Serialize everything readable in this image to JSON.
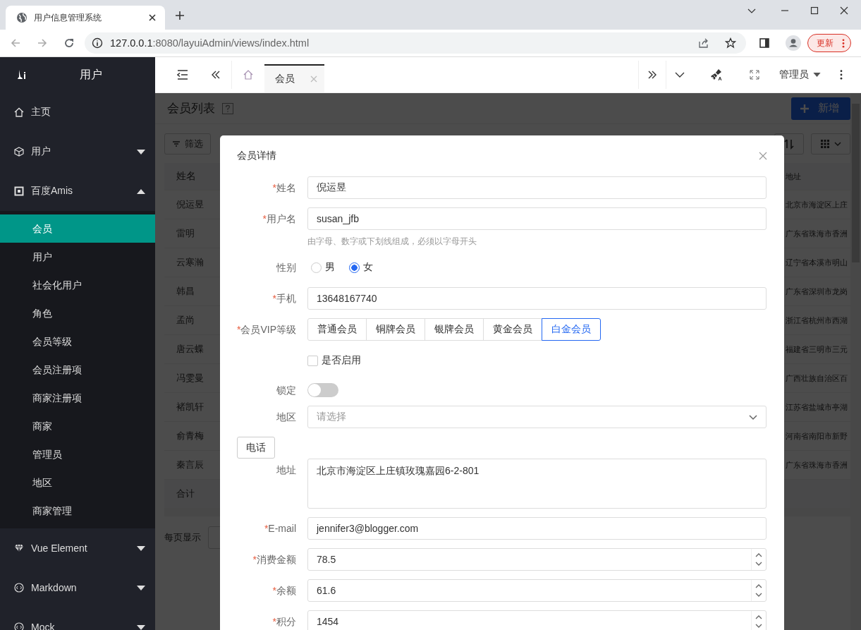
{
  "browser": {
    "tab_title": "用户信息管理系统",
    "url_host": "127.0.0.1",
    "url_path": ":8080/layuiAdmin/views/index.html",
    "update_button": "更新"
  },
  "sidebar": {
    "title": "用户",
    "items": [
      {
        "kind": "link",
        "label": "主页"
      },
      {
        "kind": "group",
        "label": "用户",
        "expanded": false
      },
      {
        "kind": "group",
        "label": "百度Amis",
        "expanded": true,
        "children": [
          {
            "label": "会员",
            "selected": true
          },
          {
            "label": "用户",
            "selected": false
          },
          {
            "label": "社会化用户",
            "selected": false
          },
          {
            "label": "角色",
            "selected": false
          },
          {
            "label": "会员等级",
            "selected": false
          },
          {
            "label": "会员注册项",
            "selected": false
          },
          {
            "label": "商家注册项",
            "selected": false
          },
          {
            "label": "商家",
            "selected": false
          },
          {
            "label": "管理员",
            "selected": false
          },
          {
            "label": "地区",
            "selected": false
          },
          {
            "label": "商家管理",
            "selected": false
          }
        ]
      },
      {
        "kind": "group",
        "label": "Vue Element",
        "expanded": false
      },
      {
        "kind": "group",
        "label": "Markdown",
        "expanded": false
      },
      {
        "kind": "group",
        "label": "Mock",
        "expanded": false
      }
    ]
  },
  "header": {
    "tabs": [
      {
        "label": "会员",
        "selected": true
      }
    ],
    "user": "管理员"
  },
  "page": {
    "title": "会员列表",
    "add_button": "新增",
    "filter_button": "筛选",
    "columns": [
      "姓名",
      "地址"
    ],
    "rows": [
      {
        "name": "倪运昱",
        "address": "北京市海淀区上庄"
      },
      {
        "name": "雷明",
        "address": "广东省珠海市香洲"
      },
      {
        "name": "云寒瀚",
        "address": "辽宁省本溪市明山"
      },
      {
        "name": "韩昌",
        "address": "广东省深圳市龙岗"
      },
      {
        "name": "孟尚",
        "address": "浙江省杭州市西湖"
      },
      {
        "name": "唐云蝶",
        "address": "福建省三明市三元"
      },
      {
        "name": "冯雯曼",
        "address": "广西壮族自治区百"
      },
      {
        "name": "褚凯轩",
        "address": "江苏省盐城市亭湖"
      },
      {
        "name": "俞青梅",
        "address": "河南省南阳市新野"
      },
      {
        "name": "秦言辰",
        "address": "广东省珠海市香洲"
      }
    ],
    "total_label": "合计",
    "page_size_label": "每页显示"
  },
  "modal": {
    "title": "会员详情",
    "fields": [
      {
        "kind": "text",
        "required_mark": "*",
        "label": "姓名",
        "value": "倪运昱"
      },
      {
        "kind": "text",
        "required_mark": "*",
        "label": "用户名",
        "value": "susan_jfb",
        "help": "由字母、数字或下划线组成，必须以字母开头"
      },
      {
        "kind": "radio",
        "label": "性别",
        "options": [
          {
            "label": "男",
            "selected": false
          },
          {
            "label": "女",
            "selected": true
          }
        ]
      },
      {
        "kind": "text",
        "required_mark": "*",
        "label": "手机",
        "value": "13648167740"
      },
      {
        "kind": "segmented",
        "required_mark": "*",
        "label": "会员VIP等级",
        "options": [
          {
            "label": "普通会员",
            "selected": false
          },
          {
            "label": "铜牌会员",
            "selected": false
          },
          {
            "label": "银牌会员",
            "selected": false
          },
          {
            "label": "黄金会员",
            "selected": false
          },
          {
            "label": "白金会员",
            "selected": true
          }
        ]
      },
      {
        "kind": "checkbox",
        "text": "是否启用",
        "checked": false
      },
      {
        "kind": "switch",
        "label": "锁定",
        "on": false
      },
      {
        "kind": "select",
        "label": "地区",
        "placeholder": "请选择"
      },
      {
        "kind": "button",
        "text": "电话"
      },
      {
        "kind": "textarea",
        "label": "地址",
        "value": "北京市海淀区上庄镇玫瑰嘉园6-2-801"
      },
      {
        "kind": "text",
        "required_mark": "*",
        "label": "E-mail",
        "value": "jennifer3@blogger.com"
      },
      {
        "kind": "number",
        "required_mark": "*",
        "label": "消费金额",
        "value": "78.5"
      },
      {
        "kind": "number",
        "required_mark": "*",
        "label": "余额",
        "value": "61.6"
      },
      {
        "kind": "number",
        "required_mark": "*",
        "label": "积分",
        "value": "1454"
      }
    ]
  }
}
